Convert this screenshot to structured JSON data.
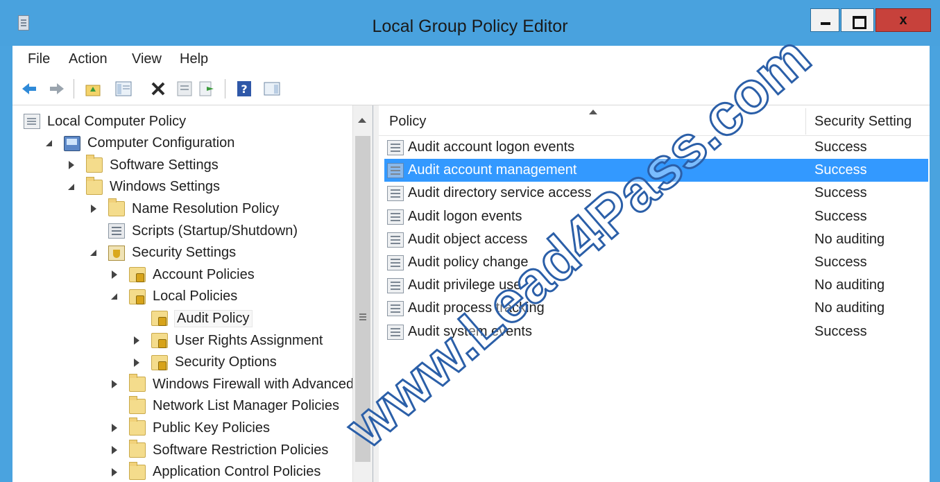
{
  "window": {
    "title": "Local Group Policy Editor",
    "close_glyph": "x"
  },
  "menu": {
    "items": [
      "File",
      "Action",
      "View",
      "Help"
    ]
  },
  "toolbar": {
    "icons": [
      "back-icon",
      "forward-icon",
      "up-folder-icon",
      "show-hide-tree-icon",
      "delete-icon",
      "properties-icon",
      "export-list-icon",
      "help-icon",
      "show-hide-action-pane-icon"
    ]
  },
  "tree": {
    "items": [
      {
        "label": "Local Computer Policy",
        "level": 0,
        "toggle": "leaf",
        "icon": "doc"
      },
      {
        "label": "Computer Configuration",
        "level": 1,
        "toggle": "expanded",
        "icon": "computer"
      },
      {
        "label": "Software Settings",
        "level": 2,
        "toggle": "collapsed",
        "icon": "folder"
      },
      {
        "label": "Windows Settings",
        "level": 2,
        "toggle": "expanded",
        "icon": "folder"
      },
      {
        "label": "Name Resolution Policy",
        "level": 3,
        "toggle": "collapsed",
        "icon": "folder"
      },
      {
        "label": "Scripts (Startup/Shutdown)",
        "level": 3,
        "toggle": "leaf",
        "icon": "script"
      },
      {
        "label": "Security Settings",
        "level": 3,
        "toggle": "expanded",
        "icon": "shield"
      },
      {
        "label": "Account Policies",
        "level": 4,
        "toggle": "collapsed",
        "icon": "secfolder"
      },
      {
        "label": "Local Policies",
        "level": 4,
        "toggle": "expanded",
        "icon": "secfolder"
      },
      {
        "label": "Audit Policy",
        "level": 5,
        "toggle": "leaf",
        "icon": "secfolder",
        "selected": true
      },
      {
        "label": "User Rights Assignment",
        "level": 5,
        "toggle": "collapsed",
        "icon": "secfolder"
      },
      {
        "label": "Security Options",
        "level": 5,
        "toggle": "collapsed",
        "icon": "secfolder"
      },
      {
        "label": "Windows Firewall with Advanced",
        "level": 4,
        "toggle": "collapsed",
        "icon": "folder"
      },
      {
        "label": "Network List Manager Policies",
        "level": 4,
        "toggle": "leaf",
        "icon": "folder"
      },
      {
        "label": "Public Key Policies",
        "level": 4,
        "toggle": "collapsed",
        "icon": "folder"
      },
      {
        "label": "Software Restriction Policies",
        "level": 4,
        "toggle": "collapsed",
        "icon": "folder"
      },
      {
        "label": "Application Control Policies",
        "level": 4,
        "toggle": "collapsed",
        "icon": "folder"
      }
    ]
  },
  "list": {
    "columns": [
      "Policy",
      "Security Setting"
    ],
    "rows": [
      {
        "policy": "Audit account logon events",
        "setting": "Success"
      },
      {
        "policy": "Audit account management",
        "setting": "Success",
        "selected": true
      },
      {
        "policy": "Audit directory service access",
        "setting": "Success"
      },
      {
        "policy": "Audit logon events",
        "setting": "Success"
      },
      {
        "policy": "Audit object access",
        "setting": "No auditing"
      },
      {
        "policy": "Audit policy change",
        "setting": "Success"
      },
      {
        "policy": "Audit privilege use",
        "setting": "No auditing"
      },
      {
        "policy": "Audit process tracking",
        "setting": "No auditing"
      },
      {
        "policy": "Audit system events",
        "setting": "Success"
      }
    ]
  },
  "watermark": {
    "text": "www.Lead4Pass.com"
  },
  "colors": {
    "titlebar": "#49a2de",
    "selection": "#3399ff",
    "close_button": "#c7413b"
  }
}
